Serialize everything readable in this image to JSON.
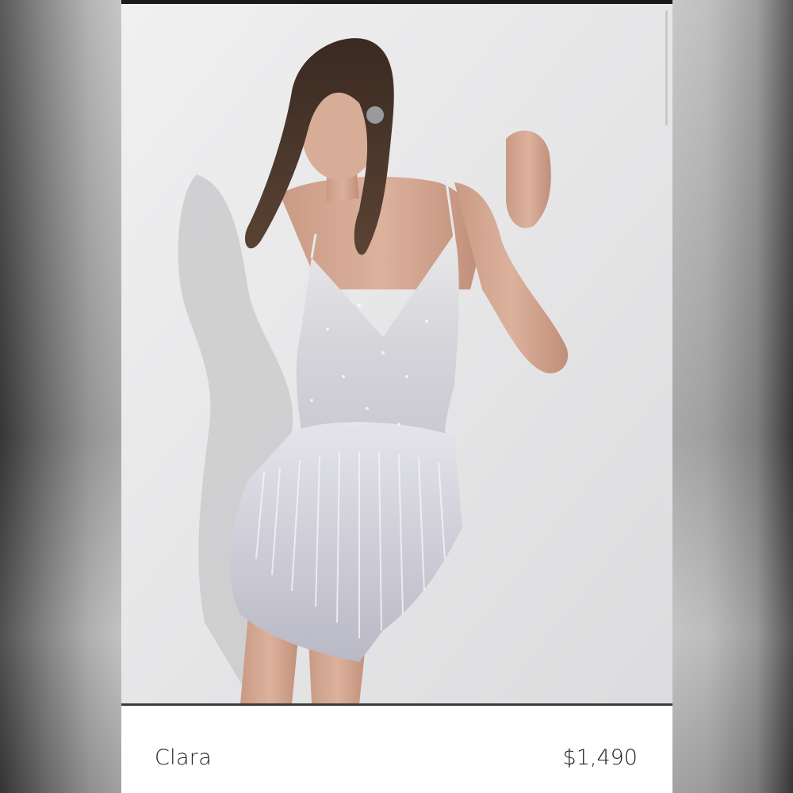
{
  "product": {
    "name": "Clara",
    "price": "$1,490",
    "photo_icon": "product-photo"
  },
  "colors": {
    "background": "#ececec",
    "card": "#ffffff",
    "text": "#222222",
    "dress": "#d9d9de"
  }
}
